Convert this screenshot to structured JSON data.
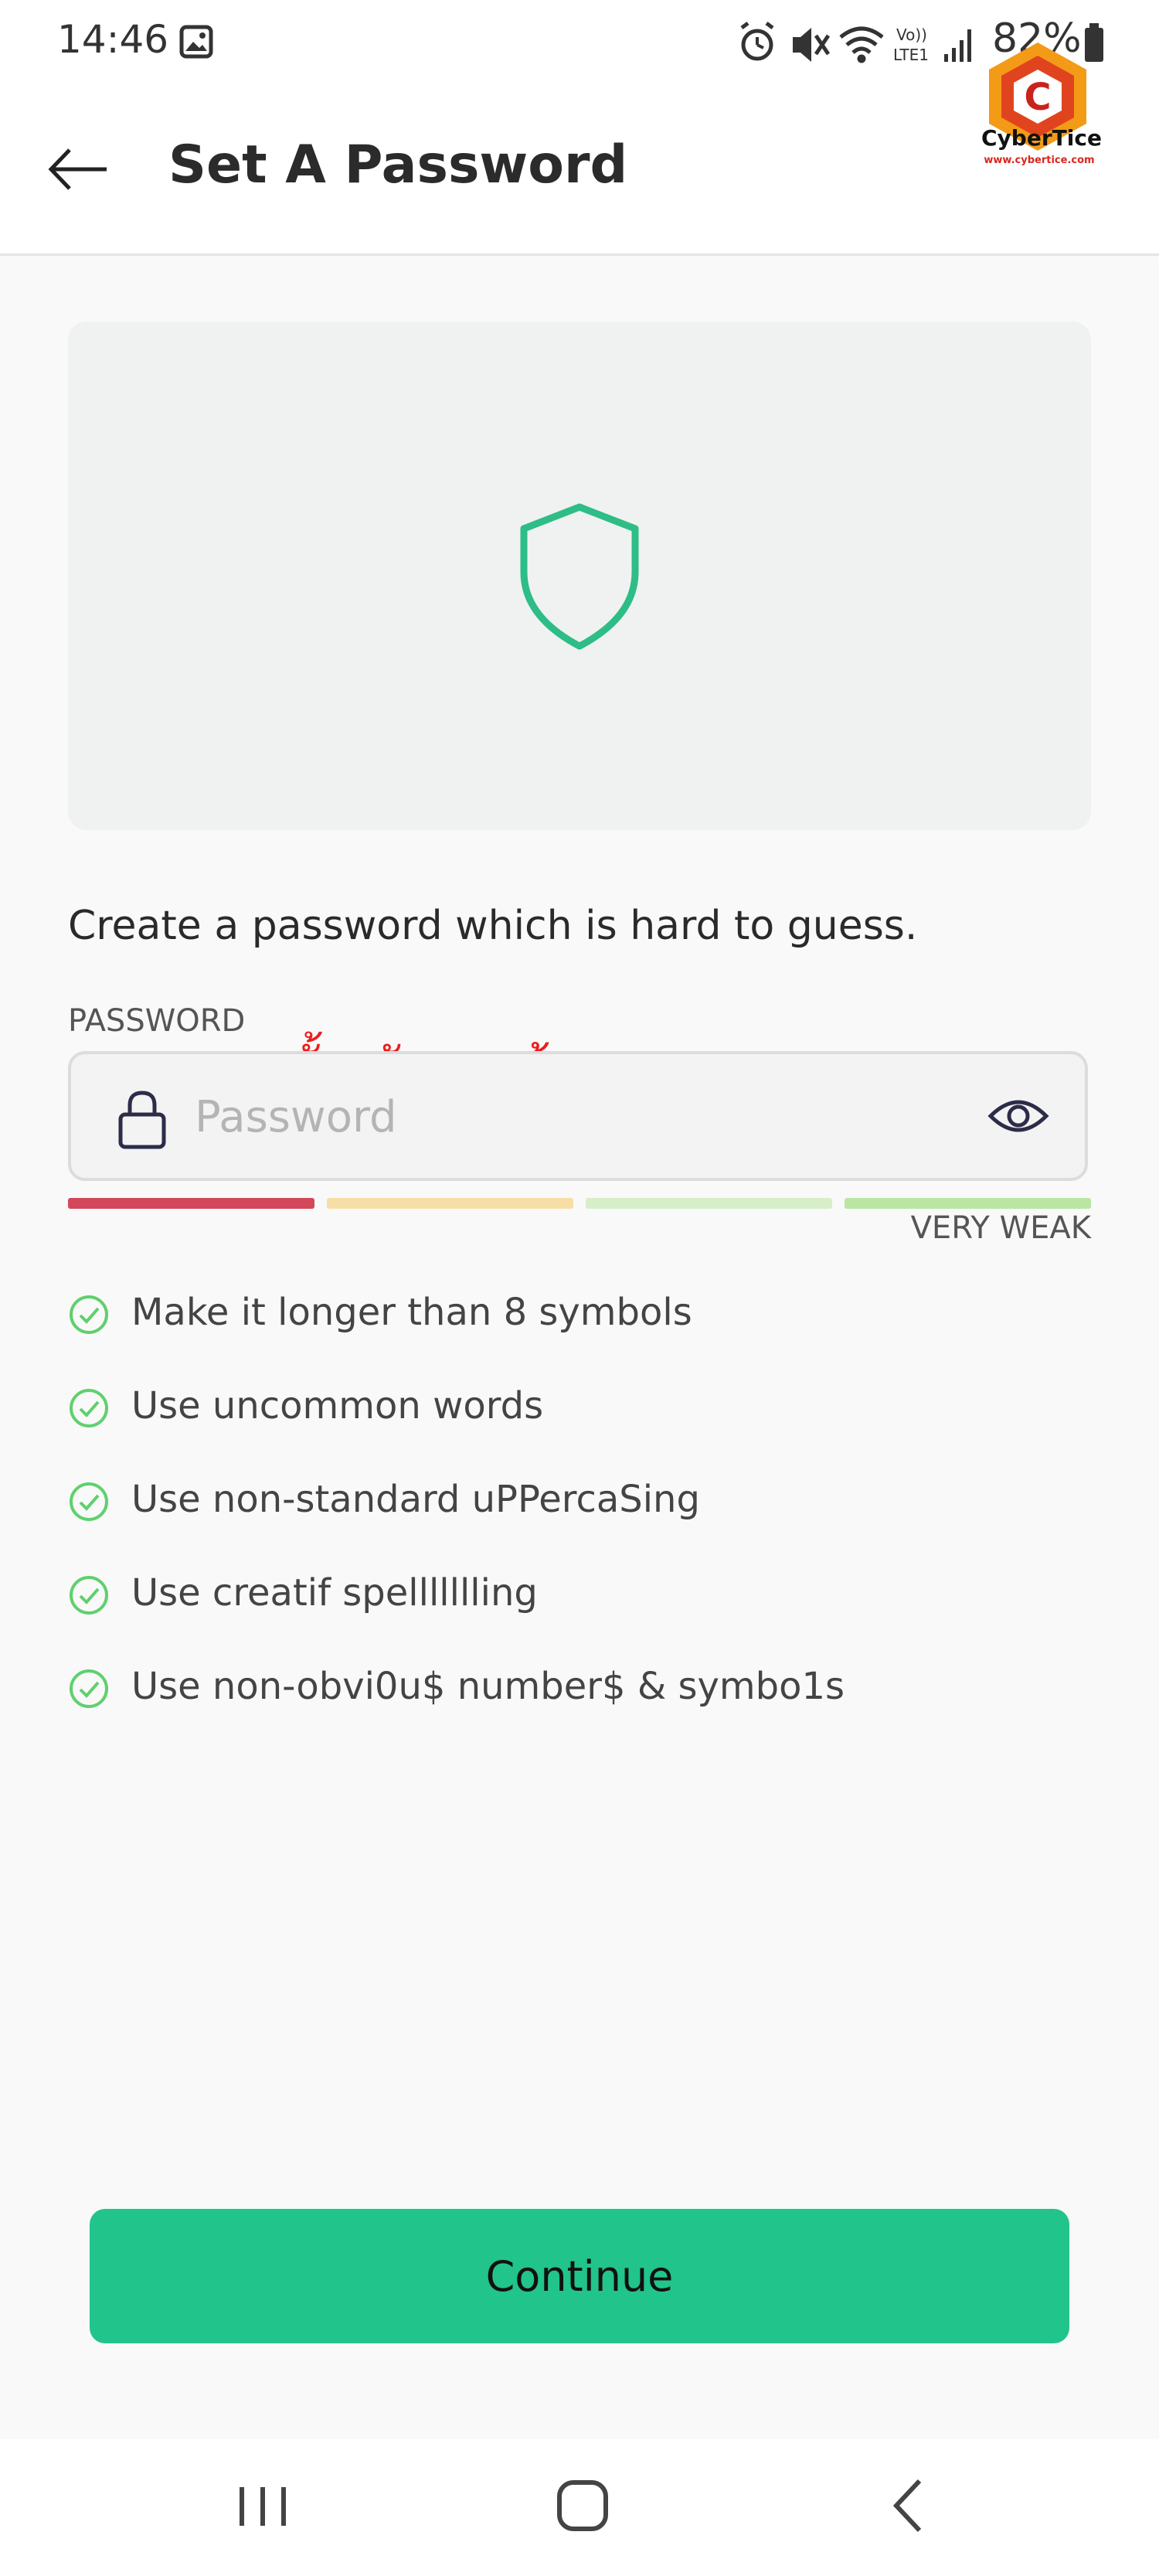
{
  "status_bar": {
    "time": "14:46",
    "battery": "82%",
    "icons": [
      "image-icon",
      "alarm-icon",
      "mute-icon",
      "wifi-icon",
      "volte-icon",
      "signal-icon",
      "battery-icon"
    ]
  },
  "header": {
    "title": "Set A Password",
    "back_icon": "arrow-left-icon"
  },
  "watermark": {
    "name": "CyberTice",
    "url": "www.cybertice.com"
  },
  "hero": {
    "icon": "shield-icon"
  },
  "form": {
    "instruction": "Create a password which is hard to guess.",
    "label": "PASSWORD",
    "placeholder": "Password",
    "value": "",
    "annotation": "ตั้งรหัสตามต้องการ",
    "strength": {
      "label": "VERY WEAK",
      "filled_segments": 1,
      "total_segments": 4,
      "colors": [
        "#d2485a",
        "#f7dea6",
        "#d6efc9",
        "#b9e6a3"
      ]
    }
  },
  "tips": [
    "Make it longer than 8 symbols",
    "Use uncommon words",
    "Use non-standard uPPercaSing",
    "Use creatif spellllllling",
    "Use non-obvi0u$ number$ & symbo1s"
  ],
  "continue_label": "Continue",
  "colors": {
    "accent": "#21c48b",
    "shield": "#2ebd86",
    "check": "#5fd06d",
    "annotation": "#ee1c1c"
  }
}
